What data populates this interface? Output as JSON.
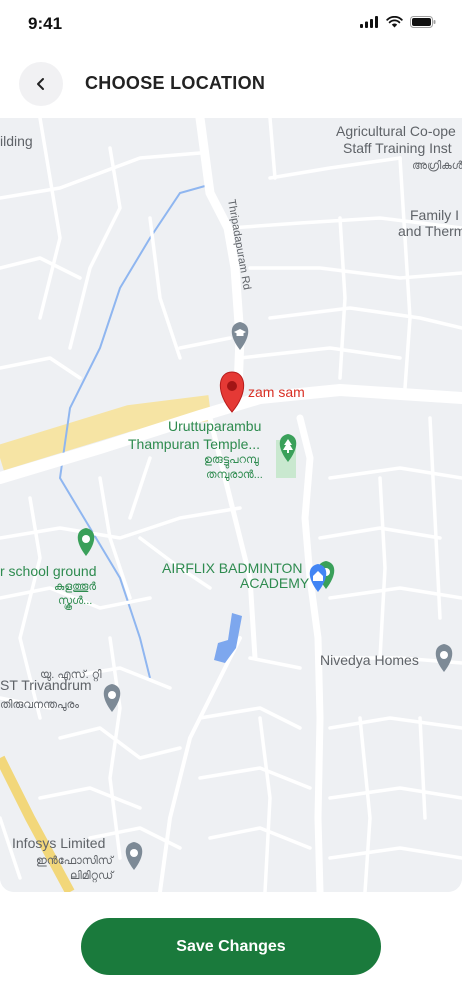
{
  "status_bar": {
    "time": "9:41"
  },
  "header": {
    "title": "CHOOSE LOCATION"
  },
  "map": {
    "labels": {
      "building_partial": "ilding",
      "agri_line1": "Agricultural Co-ope",
      "agri_line2": "Staff Training Inst",
      "agri_ml": "അഗ്രികൾ",
      "family_line1": "Family I",
      "family_line2": "and Therm",
      "road_name": "Thripadapuram Rd",
      "pin_label": "zam sam",
      "temple_line1": "Uruttuparambu",
      "temple_line2": "Thampuran Temple...",
      "temple_ml1": "ഉരുട്ടുപറമ്പു",
      "temple_ml2": "തമ്പുരാൻ...",
      "school_line1": "r school ground",
      "school_ml1": "കുളത്തൂർ",
      "school_ml2": "സ്കൂൾ...",
      "airflix_line1": "AIRFLIX BADMINTON",
      "airflix_line2": "ACADEMY",
      "nivedya": "Nivedya Homes",
      "ust_line1": "ST Trivandrum",
      "ust_ml": "തിരുവനന്തപുരം",
      "ust_ml2": "യു. എസ്. റ്റി",
      "infosys_line1": "Infosys Limited",
      "infosys_ml1": "ഇൻഫോസിസ്",
      "infosys_ml2": "ലിമിറ്റഡ്"
    },
    "colors": {
      "road": "#ffffff",
      "background": "#eef0f3",
      "water": "#7baaf7",
      "highway": "#f8e7a6",
      "poi_green": "#3aa05a",
      "poi_gray": "#7d8a96",
      "pin_red": "#e53935"
    }
  },
  "footer": {
    "save_label": "Save Changes"
  }
}
